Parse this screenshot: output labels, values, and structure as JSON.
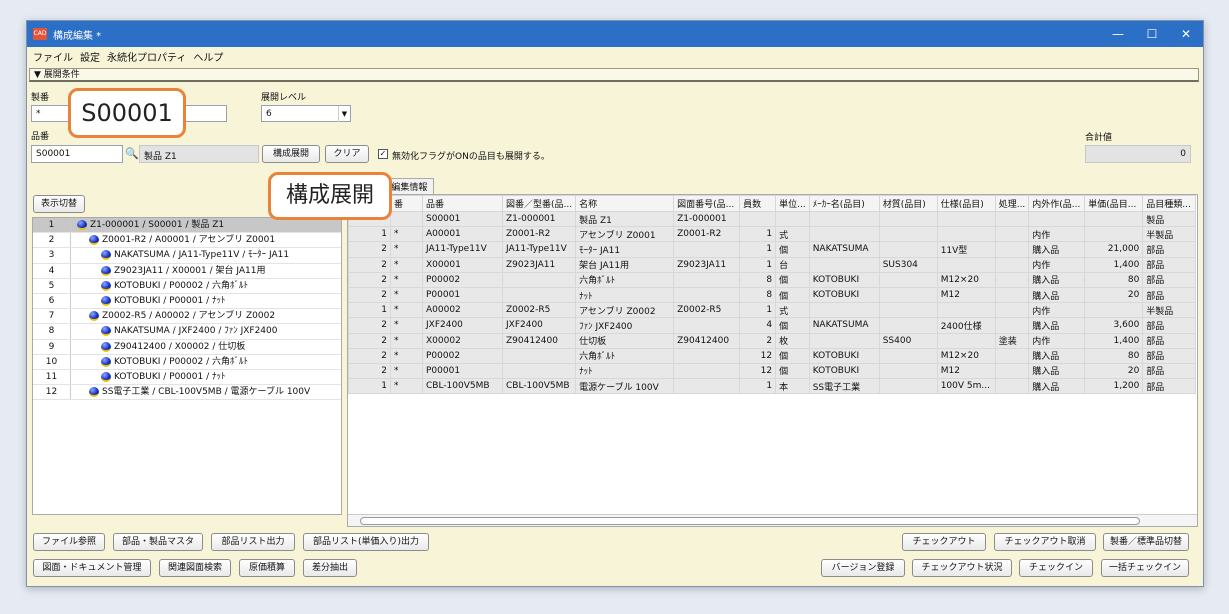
{
  "window": {
    "app_icon": "CAD",
    "title": "構成編集 *",
    "min": "—",
    "max": "☐",
    "close": "✕"
  },
  "menu": [
    "ファイル",
    "設定",
    "永続化プロパティ",
    "ヘルプ"
  ],
  "section_header": "▼ 展開条件",
  "form": {
    "seiban_label": "製番",
    "seiban_value": "*",
    "level_label": "展開レベル",
    "level_value": "6",
    "hinban_label": "品番",
    "hinban_value": "S00001",
    "hinban_name": "製品 Z1",
    "expand_button": "構成展開",
    "clear_button": "クリア",
    "checkbox_label": "無効化フラグがONの品目も展開する。",
    "checkbox_checked": true,
    "total_label": "合計値",
    "total_value": "0"
  },
  "display_toggle": "表示切替",
  "tabs": [
    "編集情報"
  ],
  "tree": [
    {
      "num": "1",
      "label": "Z1-000001 / S00001 / 製品 Z1",
      "level": 0
    },
    {
      "num": "2",
      "label": "Z0001-R2 / A00001 / アセンブリ Z0001",
      "level": 1
    },
    {
      "num": "3",
      "label": "NAKATSUMA / JA11-Type11V / ﾓｰﾀｰ JA11",
      "level": 2
    },
    {
      "num": "4",
      "label": "Z9023JA11 / X00001 / 架台 JA11用",
      "level": 2
    },
    {
      "num": "5",
      "label": "KOTOBUKI / P00002 / 六角ﾎﾞﾙﾄ",
      "level": 2
    },
    {
      "num": "6",
      "label": "KOTOBUKI / P00001 / ﾅｯﾄ",
      "level": 2
    },
    {
      "num": "7",
      "label": "Z0002-R5 / A00002 / アセンブリ Z0002",
      "level": 1
    },
    {
      "num": "8",
      "label": "NAKATSUMA / JXF2400 / ﾌｧﾝ JXF2400",
      "level": 2
    },
    {
      "num": "9",
      "label": "Z90412400 / X00002 / 仕切板",
      "level": 2
    },
    {
      "num": "10",
      "label": "KOTOBUKI / P00002 / 六角ﾎﾞﾙﾄ",
      "level": 2
    },
    {
      "num": "11",
      "label": "KOTOBUKI / P00001 / ﾅｯﾄ",
      "level": 2
    },
    {
      "num": "12",
      "label": "SS電子工業 / CBL-100V5MB / 電源ケーブル 100V",
      "level": 1
    }
  ],
  "grid": {
    "columns": [
      "",
      "番",
      "品番",
      "図番／型番(品...",
      "名称",
      "図面番号(品...",
      "員数",
      "単位...",
      "ﾒｰｶｰ名(品目)",
      "材質(品目)",
      "仕様(品目)",
      "処理...",
      "内外作(品...",
      "単価(品目...",
      "品目種類..."
    ],
    "rows": [
      [
        "",
        "",
        "S00001",
        "Z1-000001",
        "製品 Z1",
        "Z1-000001",
        "",
        "",
        "",
        "",
        "",
        "",
        "",
        "",
        "製品"
      ],
      [
        "1",
        "*",
        "A00001",
        "Z0001-R2",
        "アセンブリ Z0001",
        "Z0001-R2",
        "1",
        "式",
        "",
        "",
        "",
        "",
        "内作",
        "",
        "半製品"
      ],
      [
        "2",
        "*",
        "JA11-Type11V",
        "JA11-Type11V",
        "ﾓｰﾀｰ JA11",
        "",
        "1",
        "個",
        "NAKATSUMA",
        "",
        "11V型",
        "",
        "購入品",
        "21,000",
        "部品"
      ],
      [
        "2",
        "*",
        "X00001",
        "Z9023JA11",
        "架台 JA11用",
        "Z9023JA11",
        "1",
        "台",
        "",
        "SUS304",
        "",
        "",
        "内作",
        "1,400",
        "部品"
      ],
      [
        "2",
        "*",
        "P00002",
        "",
        "六角ﾎﾞﾙﾄ",
        "",
        "8",
        "個",
        "KOTOBUKI",
        "",
        "M12×20",
        "",
        "購入品",
        "80",
        "部品"
      ],
      [
        "2",
        "*",
        "P00001",
        "",
        "ﾅｯﾄ",
        "",
        "8",
        "個",
        "KOTOBUKI",
        "",
        "M12",
        "",
        "購入品",
        "20",
        "部品"
      ],
      [
        "1",
        "*",
        "A00002",
        "Z0002-R5",
        "アセンブリ Z0002",
        "Z0002-R5",
        "1",
        "式",
        "",
        "",
        "",
        "",
        "内作",
        "",
        "半製品"
      ],
      [
        "2",
        "*",
        "JXF2400",
        "JXF2400",
        "ﾌｧﾝ JXF2400",
        "",
        "4",
        "個",
        "NAKATSUMA",
        "",
        "2400仕様",
        "",
        "購入品",
        "3,600",
        "部品"
      ],
      [
        "2",
        "*",
        "X00002",
        "Z90412400",
        "仕切板",
        "Z90412400",
        "2",
        "枚",
        "",
        "SS400",
        "",
        "塗装",
        "内作",
        "1,400",
        "部品"
      ],
      [
        "2",
        "*",
        "P00002",
        "",
        "六角ﾎﾞﾙﾄ",
        "",
        "12",
        "個",
        "KOTOBUKI",
        "",
        "M12×20",
        "",
        "購入品",
        "80",
        "部品"
      ],
      [
        "2",
        "*",
        "P00001",
        "",
        "ﾅｯﾄ",
        "",
        "12",
        "個",
        "KOTOBUKI",
        "",
        "M12",
        "",
        "購入品",
        "20",
        "部品"
      ],
      [
        "1",
        "*",
        "CBL-100V5MB",
        "CBL-100V5MB",
        "電源ケーブル 100V",
        "",
        "1",
        "本",
        "SS電子工業",
        "",
        "100V 5m...",
        "",
        "購入品",
        "1,200",
        "部品"
      ]
    ]
  },
  "bottom_row1_left": [
    "ファイル参照",
    "部品・製品マスタ",
    "部品リスト出力",
    "部品リスト(単価入り)出力"
  ],
  "bottom_row1_right": [
    "チェックアウト",
    "チェックアウト取消",
    "製番／標準品切替"
  ],
  "bottom_row2_left": [
    "図面・ドキュメント管理",
    "関連図面検索",
    "原価積算",
    "差分抽出"
  ],
  "bottom_row2_right": [
    "バージョン登録",
    "チェックアウト状況",
    "チェックイン",
    "一括チェックイン"
  ],
  "callouts": {
    "hinban": "S00001",
    "expand": "構成展開"
  }
}
